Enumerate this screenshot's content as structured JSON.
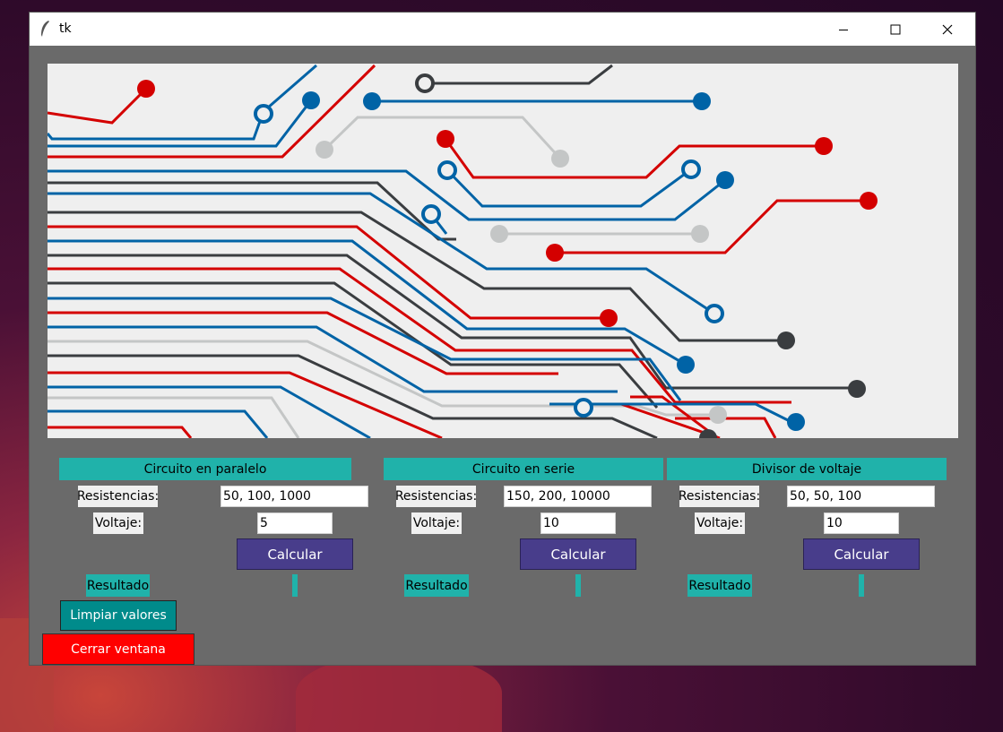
{
  "window": {
    "title": "tk"
  },
  "panels": [
    {
      "header": "Circuito en paralelo",
      "res_label": "Resistencias:",
      "res_value": "50, 100, 1000",
      "volt_label": "Voltaje:",
      "volt_value": "5",
      "calc_label": "Calcular",
      "result_label": "Resultado",
      "result_value": ""
    },
    {
      "header": "Circuito en serie",
      "res_label": "Resistencias:",
      "res_value": "150, 200, 10000",
      "volt_label": "Voltaje:",
      "volt_value": "10",
      "calc_label": "Calcular",
      "result_label": "Resultado",
      "result_value": ""
    },
    {
      "header": "Divisor de voltaje",
      "res_label": "Resistencias:",
      "res_value": "50, 50, 100",
      "volt_label": "Voltaje:",
      "volt_value": "10",
      "calc_label": "Calcular",
      "result_label": "Resultado",
      "result_value": ""
    }
  ],
  "actions": {
    "clear_label": "Limpiar valores",
    "close_label": "Cerrar ventana"
  },
  "colors": {
    "accent": "#20b2aa",
    "calc": "#483d8b",
    "clear": "#008b8b",
    "close": "#ff0000",
    "window_bg": "#6a6a6a",
    "circuit_red": "#d40000",
    "circuit_blue": "#0063a6",
    "circuit_dark": "#3a3d40",
    "circuit_grey": "#c4c6c6"
  },
  "icons": {
    "app": "feather-icon",
    "minimize": "minimize-icon",
    "maximize": "maximize-icon",
    "close": "close-icon"
  }
}
